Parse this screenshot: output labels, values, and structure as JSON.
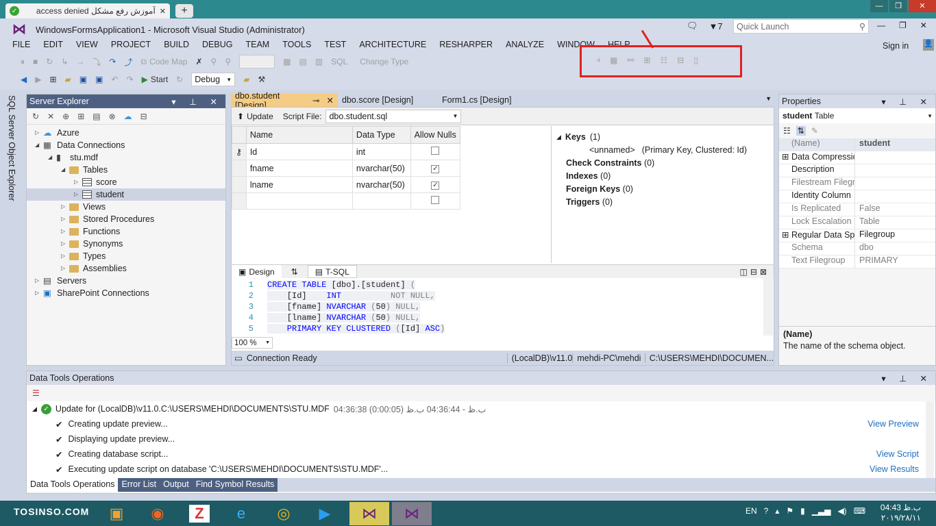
{
  "browser": {
    "tab_title": "آموزش رفع مشکل access denied",
    "new_tab": "+",
    "win_min": "—",
    "win_max": "❐",
    "win_close": "✕"
  },
  "vs": {
    "title": "WindowsFormsApplication1 - Microsoft Visual Studio (Administrator)",
    "notif_count": "7",
    "quick_launch_placeholder": "Quick Launch",
    "sign_in": "Sign in",
    "menu": [
      "FILE",
      "EDIT",
      "VIEW",
      "PROJECT",
      "BUILD",
      "DEBUG",
      "TEAM",
      "TOOLS",
      "TEST",
      "ARCHITECTURE",
      "RESHARPER",
      "ANALYZE",
      "WINDOW",
      "HELP"
    ],
    "toolbar": {
      "code_map": "Code Map",
      "change_type": "Change Type",
      "start": "Start",
      "config": "Debug"
    }
  },
  "side_tab": "SQL Server Object Explorer",
  "server_explorer": {
    "title": "Server Explorer",
    "tree": [
      {
        "label": "Azure",
        "level": 0,
        "icon": "cloud-icon",
        "arrow": "▷"
      },
      {
        "label": "Data Connections",
        "level": 0,
        "icon": "database-icon",
        "arrow": "◢"
      },
      {
        "label": "stu.mdf",
        "level": 1,
        "icon": "database-file-icon",
        "arrow": "◢"
      },
      {
        "label": "Tables",
        "level": 2,
        "icon": "folder-icon",
        "arrow": "◢"
      },
      {
        "label": "score",
        "level": 3,
        "icon": "table-icon",
        "arrow": "▷"
      },
      {
        "label": "student",
        "level": 3,
        "icon": "table-icon",
        "arrow": "▷",
        "selected": true
      },
      {
        "label": "Views",
        "level": 2,
        "icon": "folder-icon",
        "arrow": "▷"
      },
      {
        "label": "Stored Procedures",
        "level": 2,
        "icon": "folder-icon",
        "arrow": "▷"
      },
      {
        "label": "Functions",
        "level": 2,
        "icon": "folder-icon",
        "arrow": "▷"
      },
      {
        "label": "Synonyms",
        "level": 2,
        "icon": "folder-icon",
        "arrow": "▷"
      },
      {
        "label": "Types",
        "level": 2,
        "icon": "folder-icon",
        "arrow": "▷"
      },
      {
        "label": "Assemblies",
        "level": 2,
        "icon": "folder-icon",
        "arrow": "▷"
      },
      {
        "label": "Servers",
        "level": 0,
        "icon": "server-icon",
        "arrow": "▷"
      },
      {
        "label": "SharePoint Connections",
        "level": 0,
        "icon": "sharepoint-icon",
        "arrow": "▷"
      }
    ]
  },
  "doc_tabs": [
    "dbo.student [Design]",
    "dbo.score [Design]",
    "Form1.cs [Design]"
  ],
  "designer": {
    "update": "Update",
    "script_file_label": "Script File:",
    "script_file": "dbo.student.sql",
    "columns": [
      "Name",
      "Data Type",
      "Allow Nulls"
    ],
    "rows": [
      {
        "name": "Id",
        "type": "int",
        "nulls": false,
        "key": true
      },
      {
        "name": "fname",
        "type": "nvarchar(50)",
        "nulls": true
      },
      {
        "name": "lname",
        "type": "nvarchar(50)",
        "nulls": true
      },
      {
        "name": "",
        "type": "",
        "nulls": false
      }
    ],
    "keys": {
      "label": "Keys",
      "count": "(1)",
      "item": "<unnamed>",
      "item_desc": "(Primary Key, Clustered: Id)"
    },
    "sections": [
      {
        "label": "Check Constraints",
        "count": "(0)"
      },
      {
        "label": "Indexes",
        "count": "(0)"
      },
      {
        "label": "Foreign Keys",
        "count": "(0)"
      },
      {
        "label": "Triggers",
        "count": "(0)"
      }
    ],
    "pane_tabs": {
      "design": "Design",
      "swap": "⇅",
      "tsql": "T-SQL"
    },
    "code_lines": [
      {
        "n": "1",
        "parts": [
          [
            "kw",
            "CREATE TABLE "
          ],
          [
            "",
            "[dbo]."
          ],
          [
            "",
            "[student] "
          ],
          [
            "gr",
            "("
          ]
        ]
      },
      {
        "n": "2",
        "parts": [
          [
            "",
            "    [Id]    "
          ],
          [
            "kw",
            "INT"
          ],
          [
            "gr",
            "          NOT NULL,"
          ]
        ]
      },
      {
        "n": "3",
        "parts": [
          [
            "",
            "    [fname] "
          ],
          [
            "kw",
            "NVARCHAR "
          ],
          [
            "gr",
            "("
          ],
          [
            "",
            "50"
          ],
          [
            "gr",
            ") NULL,"
          ]
        ]
      },
      {
        "n": "4",
        "parts": [
          [
            "",
            "    [lname] "
          ],
          [
            "kw",
            "NVARCHAR "
          ],
          [
            "gr",
            "("
          ],
          [
            "",
            "50"
          ],
          [
            "gr",
            ") NULL,"
          ]
        ]
      },
      {
        "n": "5",
        "parts": [
          [
            "kw",
            "    PRIMARY KEY CLUSTERED "
          ],
          [
            "gr",
            "("
          ],
          [
            "",
            "[Id] "
          ],
          [
            "kw",
            "ASC"
          ],
          [
            "gr",
            ")"
          ]
        ]
      }
    ],
    "zoom": "100 %",
    "status": {
      "ready": "Connection Ready",
      "server": "(LocalDB)\\v11.0",
      "user": "mehdi-PC\\mehdi",
      "path": "C:\\USERS\\MEHDI\\DOCUMEN..."
    }
  },
  "properties": {
    "title": "Properties",
    "object": "student",
    "object_type": "Table",
    "rows": [
      {
        "k": "(Name)",
        "v": "student",
        "dim": true,
        "bold": true
      },
      {
        "k": "Data Compressio",
        "v": "",
        "expand": true
      },
      {
        "k": "Description",
        "v": ""
      },
      {
        "k": "Filestream Filegro",
        "v": "",
        "dim": true
      },
      {
        "k": "Identity Column",
        "v": ""
      },
      {
        "k": "Is Replicated",
        "v": "False",
        "dim": true
      },
      {
        "k": "Lock Escalation",
        "v": "Table",
        "dim": true
      },
      {
        "k": "Regular Data Spa",
        "v": "Filegroup",
        "expand": true
      },
      {
        "k": "Schema",
        "v": "dbo",
        "dim": true
      },
      {
        "k": "Text Filegroup",
        "v": "PRIMARY",
        "dim": true
      }
    ],
    "desc_title": "(Name)",
    "desc_text": "The name of the schema object."
  },
  "data_tools": {
    "title": "Data Tools Operations",
    "header": "Update for (LocalDB)\\v11.0.C:\\USERS\\MEHDI\\DOCUMENTS\\STU.MDF",
    "header_time": "04:36:38 ب.ظ - 04:36:44 ب.ظ (0:00:05)",
    "ops": [
      {
        "label": "Creating update preview...",
        "link": "View Preview"
      },
      {
        "label": "Displaying update preview...",
        "link": ""
      },
      {
        "label": "Creating database script...",
        "link": "View Script"
      },
      {
        "label": "Executing update script on database 'C:\\USERS\\MEHDI\\DOCUMENTS\\STU.MDF'...",
        "link": "View Results"
      }
    ],
    "bottom_tabs": [
      "Data Tools Operations",
      "Error List",
      "Output",
      "Find Symbol Results"
    ]
  },
  "taskbar": {
    "watermark": "TOSINSO.COM",
    "lang": "EN",
    "time": "04:43 ب.ظ",
    "date": "۲۰۱۹/۲۸/۱۱"
  }
}
